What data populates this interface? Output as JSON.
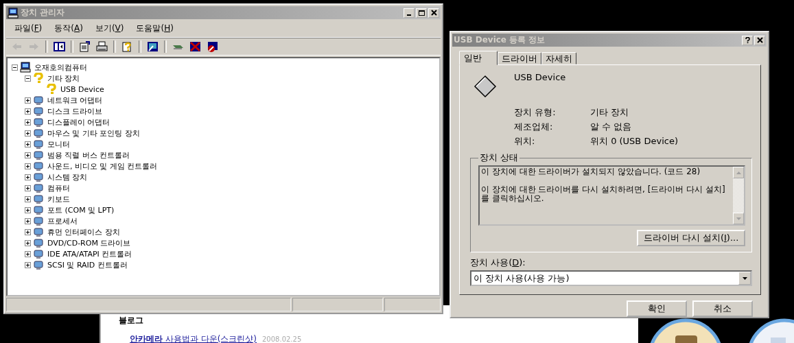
{
  "blog": {
    "heading": "블로그",
    "post": {
      "title": "**안카메라** 사용법과 다운(스크린샷)",
      "date": "2008.02.25"
    }
  },
  "device_manager": {
    "window": {
      "title": "장치 관리자",
      "active": false
    },
    "menu": [
      {
        "before": "파일(",
        "key": "F",
        "after": ")"
      },
      {
        "before": "동작(",
        "key": "A",
        "after": ")"
      },
      {
        "before": "보기(",
        "key": "V",
        "after": ")"
      },
      {
        "before": "도움말(",
        "key": "H",
        "after": ")"
      }
    ],
    "toolbar": [
      {
        "kind": "back",
        "disabled": true
      },
      {
        "kind": "forward",
        "disabled": true
      },
      {
        "kind": "sep"
      },
      {
        "kind": "panel",
        "disabled": false
      },
      {
        "kind": "sep"
      },
      {
        "kind": "properties",
        "disabled": false
      },
      {
        "kind": "print",
        "disabled": false
      },
      {
        "kind": "sep"
      },
      {
        "kind": "help",
        "disabled": false
      },
      {
        "kind": "sep"
      },
      {
        "kind": "scan",
        "disabled": false
      },
      {
        "kind": "sep"
      },
      {
        "kind": "update",
        "disabled": false
      },
      {
        "kind": "uninstall",
        "disabled": false
      },
      {
        "kind": "disable",
        "disabled": false
      }
    ],
    "tree": [
      {
        "label": "오재호의컴퓨터",
        "expanded": true,
        "children": [
          {
            "label": "기타 장치",
            "expanded": true,
            "children": [
              {
                "label": "USB Device"
              }
            ]
          },
          {
            "label": "네트워크 어댑터",
            "expanded": false
          },
          {
            "label": "디스크 드라이브",
            "expanded": false
          },
          {
            "label": "디스플레이 어댑터",
            "expanded": false
          },
          {
            "label": "마우스 및 기타 포인팅 장치",
            "expanded": false
          },
          {
            "label": "모니터",
            "expanded": false
          },
          {
            "label": "범용 직렬 버스 컨트롤러",
            "expanded": false
          },
          {
            "label": "사운드, 비디오 및 게임 컨트롤러",
            "expanded": false
          },
          {
            "label": "시스템 장치",
            "expanded": false
          },
          {
            "label": "컴퓨터",
            "expanded": false
          },
          {
            "label": "키보드",
            "expanded": false
          },
          {
            "label": "포트 (COM 및 LPT)",
            "expanded": false
          },
          {
            "label": "프로세서",
            "expanded": false
          },
          {
            "label": "휴먼 인터페이스 장치",
            "expanded": false
          },
          {
            "label": "DVD/CD-ROM 드라이브",
            "expanded": false
          },
          {
            "label": "IDE ATA/ATAPI 컨트롤러",
            "expanded": false
          },
          {
            "label": "SCSI 및 RAID 컨트롤러",
            "expanded": false
          }
        ]
      }
    ]
  },
  "properties_dialog": {
    "window": {
      "title": "USB Device 등록 정보",
      "active": false
    },
    "tabs": [
      {
        "label": "일반",
        "selected": true
      },
      {
        "label": "드라이버",
        "selected": false
      },
      {
        "label": "자세히",
        "selected": false
      }
    ],
    "device_name": "USB Device",
    "fields": [
      {
        "label": "장치 유형:",
        "value": "기타 장치"
      },
      {
        "label": "제조업체:",
        "value": "알 수 없음"
      },
      {
        "label": "위치:",
        "value": "위치 0 (USB Device)"
      }
    ],
    "status_group": {
      "title": "장치 상태",
      "paragraphs": [
        "이 장치에 대한 드라이버가 설치되지 않았습니다. (코드 28)",
        "이 장치에 대한 드라이버를 다시 설치하려면, [드라이버 다시 설치]를 클릭하십시오."
      ],
      "button": {
        "before": "드라이버 다시 설치(",
        "key": "I",
        "after": ")..."
      }
    },
    "usage": {
      "label": {
        "before": "장치 사용(",
        "key": "D",
        "after": "):"
      },
      "value": "이 장치 사용(사용 가능)"
    },
    "buttons": [
      "확인",
      "취소"
    ]
  }
}
